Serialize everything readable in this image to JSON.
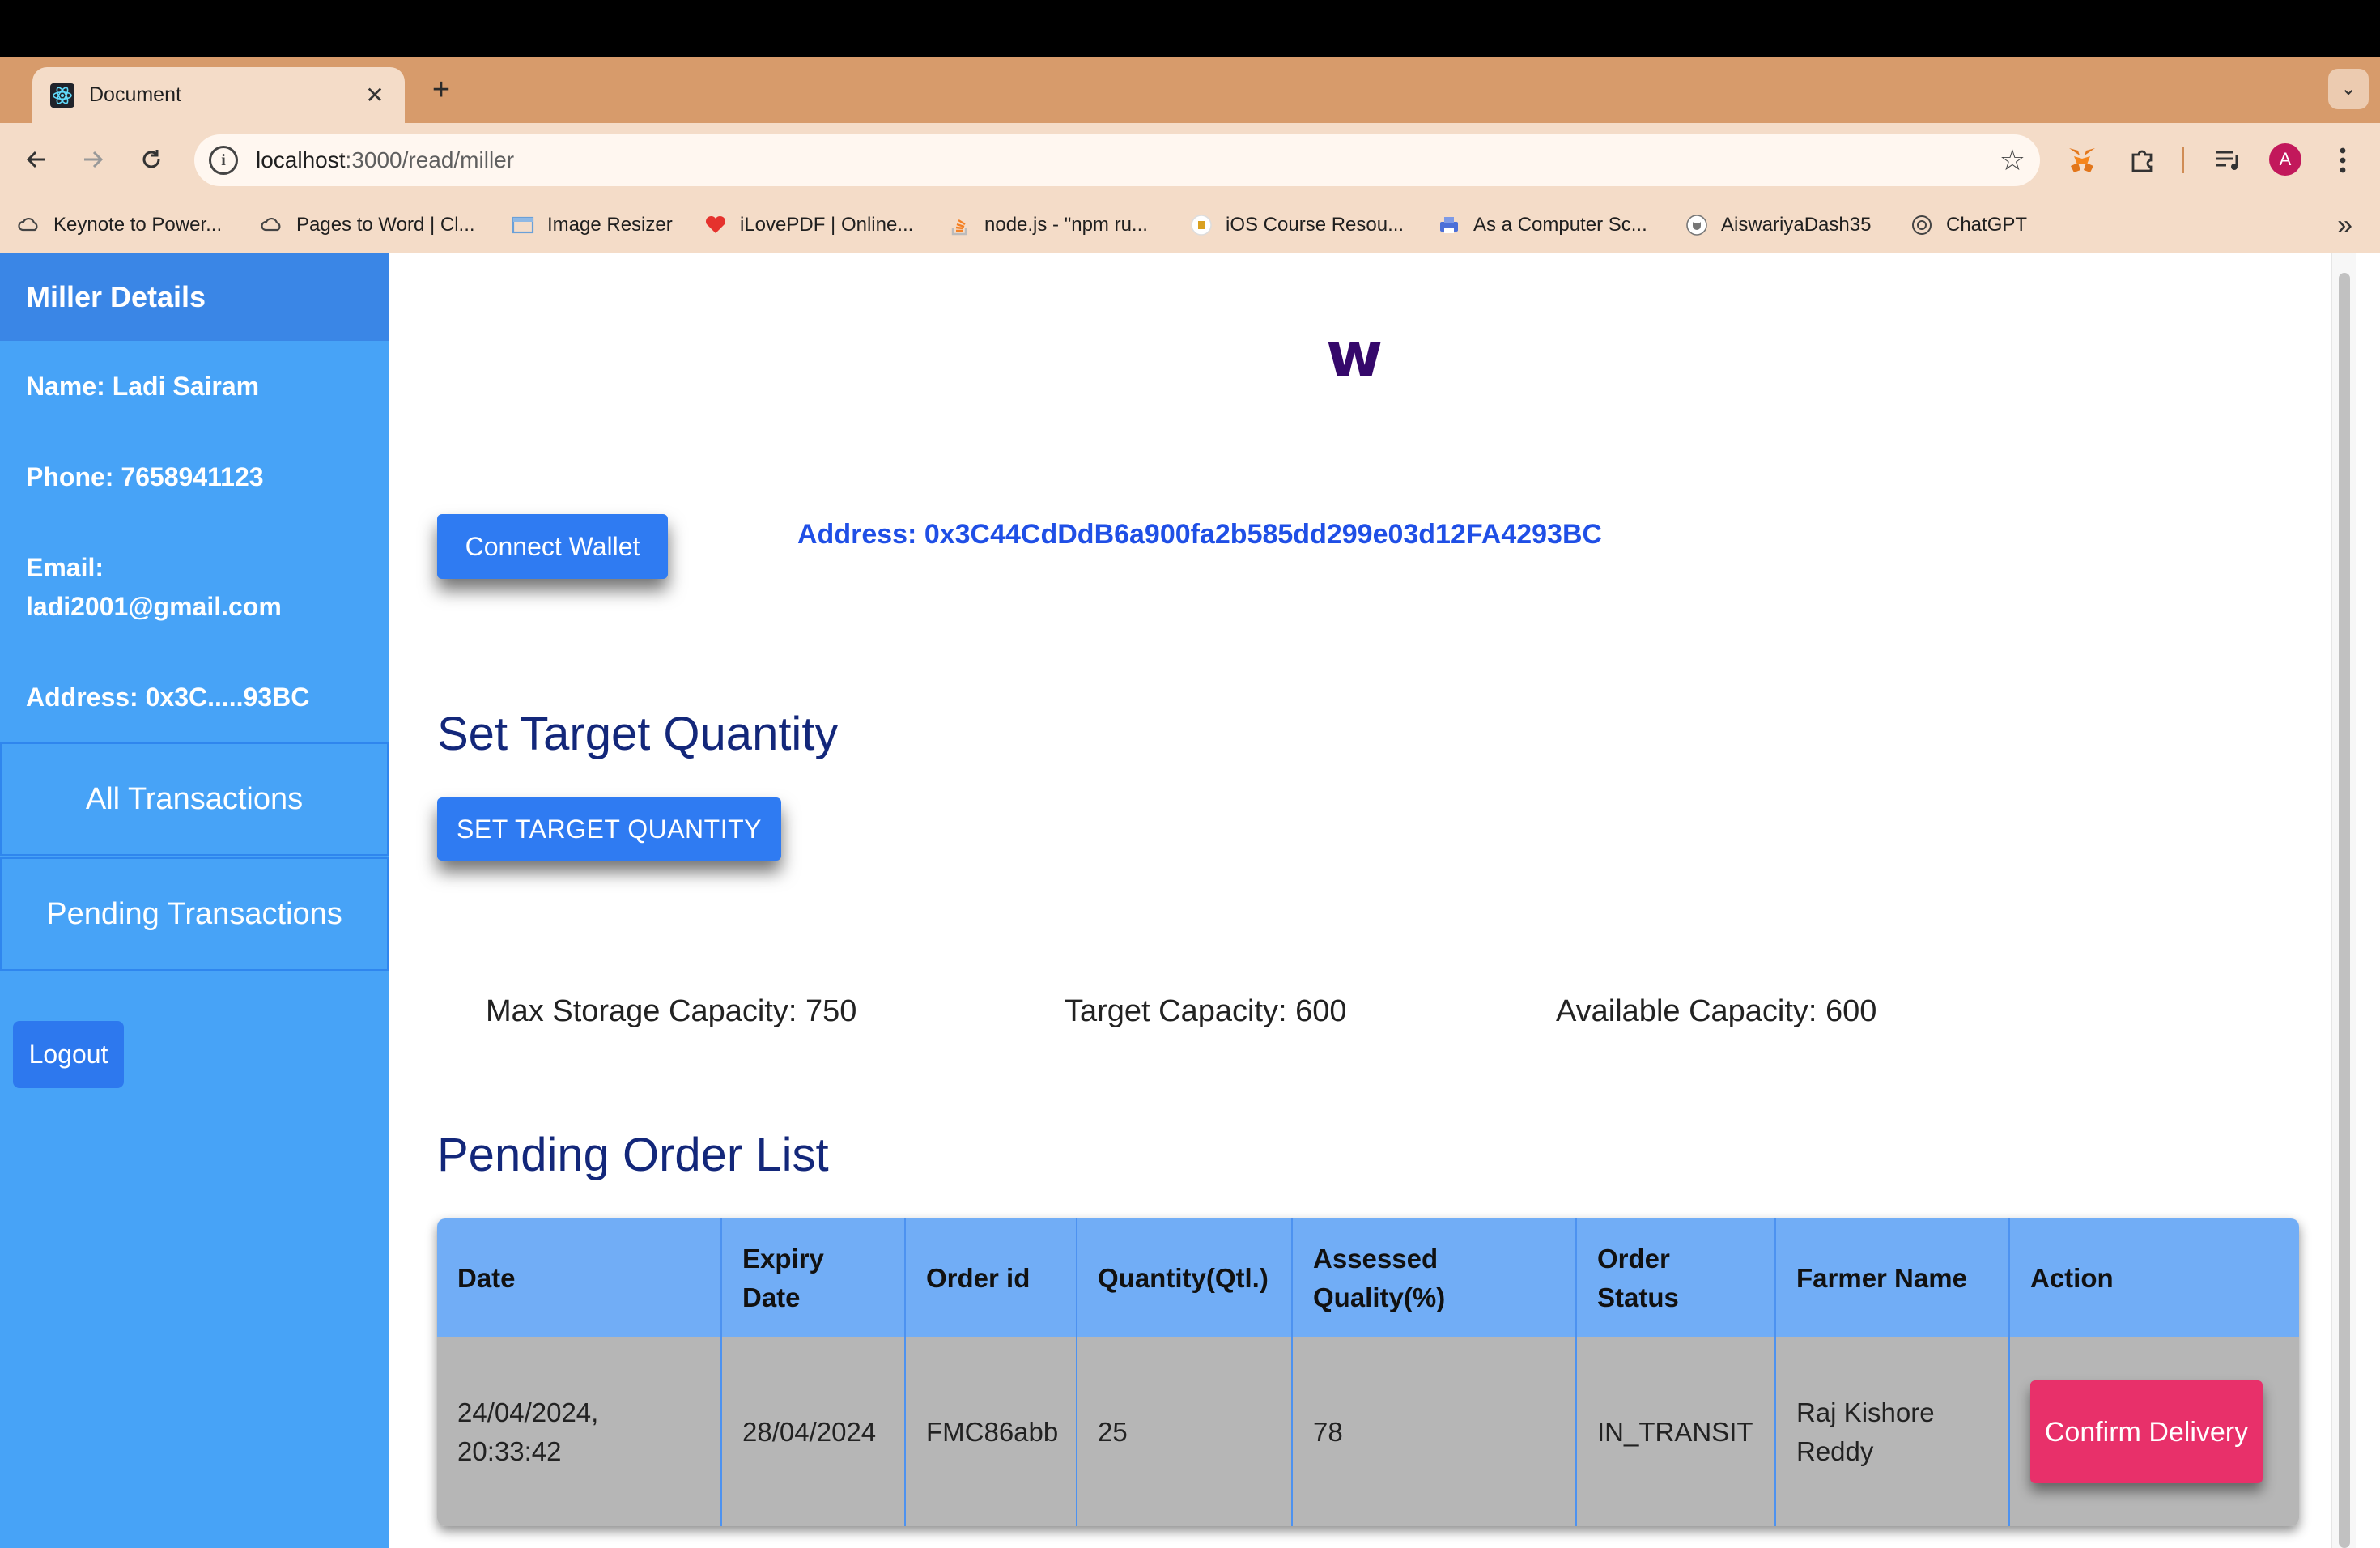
{
  "browser": {
    "tab_title": "Document",
    "url_host": "localhost",
    "url_path": ":3000/read/miller",
    "avatar_letter": "A",
    "bookmarks": [
      "Keynote to Power...",
      "Pages to Word | Cl...",
      "Image Resizer",
      "iLovePDF | Online...",
      "node.js - \"npm ru...",
      "iOS Course Resou...",
      "As a Computer Sc...",
      "AiswariyaDash35",
      "ChatGPT"
    ]
  },
  "sidebar": {
    "header": "Miller Details",
    "name": "Name: Ladi Sairam",
    "phone": "Phone: 7658941123",
    "email_label": "Email:",
    "email_value": "ladi2001@gmail.com",
    "address": "Address: 0x3C.....93BC",
    "links": [
      "All Transactions",
      "Pending Transactions"
    ],
    "logout": "Logout"
  },
  "main": {
    "logo": "w",
    "connect_wallet": "Connect Wallet",
    "wallet_address": "Address: 0x3C44CdDdB6a900fa2b585dd299e03d12FA4293BC",
    "target_title": "Set Target Quantity",
    "target_button": "SET TARGET QUANTITY",
    "max_storage": "Max Storage Capacity: 750",
    "target_capacity": "Target Capacity: 600",
    "available_capacity": "Available Capacity: 600",
    "pending_title": "Pending Order List"
  },
  "table": {
    "headers": [
      "Date",
      "Expiry Date",
      "Order id",
      "Quantity(Qtl.)",
      "Assessed Quality(%)",
      "Order Status",
      "Farmer Name",
      "Action"
    ],
    "rows": [
      {
        "date": "24/04/2024, 20:33:42",
        "expiry": "28/04/2024",
        "order_id": "FMC86abb",
        "quantity": "25",
        "quality": "78",
        "status": "IN_TRANSIT",
        "farmer": "Raj Kishore Reddy",
        "action": "Confirm Delivery"
      }
    ]
  },
  "colors": {
    "sidebar_bg": "#47a3f7",
    "sidebar_header": "#3a86e6",
    "primary_button": "#2f7bf2",
    "confirm_button": "#e8306a",
    "heading": "#13277a",
    "address_text": "#1f4fe6"
  }
}
